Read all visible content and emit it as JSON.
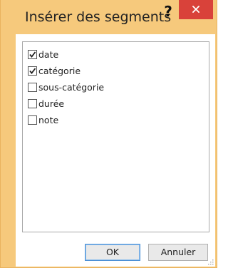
{
  "window": {
    "title": "Insérer des segments",
    "help_label": "?",
    "close_icon": "close-icon"
  },
  "list": {
    "items": [
      {
        "label": "date",
        "checked": true
      },
      {
        "label": "catégorie",
        "checked": true
      },
      {
        "label": "sous-catégorie",
        "checked": false
      },
      {
        "label": "durée",
        "checked": false
      },
      {
        "label": "note",
        "checked": false
      }
    ]
  },
  "buttons": {
    "ok_label": "OK",
    "cancel_label": "Annuler"
  },
  "colors": {
    "accent_frame": "#f6c97c",
    "close_red": "#d9423a",
    "focus_blue": "#4d90d6"
  }
}
